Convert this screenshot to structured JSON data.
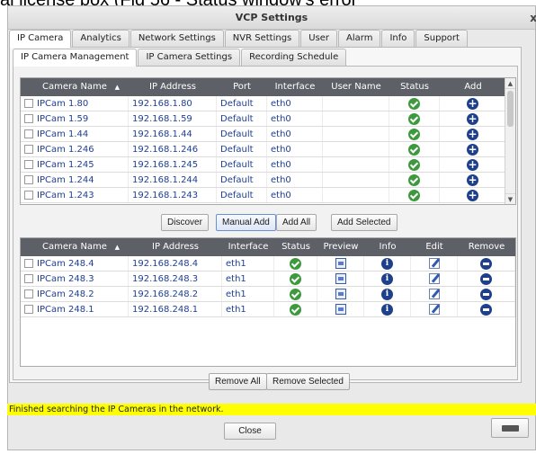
{
  "background_text": "al license box (Fig 56 - Status window's error",
  "window": {
    "title": "VCP Settings",
    "close": "x"
  },
  "main_tabs": [
    "IP Camera",
    "Analytics",
    "Network Settings",
    "NVR Settings",
    "User",
    "Alarm",
    "Info",
    "Support"
  ],
  "sub_tabs": [
    "IP Camera Management",
    "IP Camera Settings",
    "Recording Schedule"
  ],
  "discovered": {
    "headers": [
      "Camera Name",
      "IP Address",
      "Port",
      "Interface",
      "User Name",
      "Status",
      "Add"
    ],
    "sort_indicator": "▲",
    "rows": [
      {
        "name": "IPCam 1.80",
        "ip": "192.168.1.80",
        "port": "Default",
        "iface": "eth0",
        "user": "",
        "status": "ok-icon",
        "action": "add-icon"
      },
      {
        "name": "IPCam 1.59",
        "ip": "192.168.1.59",
        "port": "Default",
        "iface": "eth0",
        "user": "",
        "status": "ok-icon",
        "action": "add-icon"
      },
      {
        "name": "IPCam 1.44",
        "ip": "192.168.1.44",
        "port": "Default",
        "iface": "eth0",
        "user": "",
        "status": "ok-icon",
        "action": "add-icon"
      },
      {
        "name": "IPCam 1.246",
        "ip": "192.168.1.246",
        "port": "Default",
        "iface": "eth0",
        "user": "",
        "status": "ok-icon",
        "action": "add-icon"
      },
      {
        "name": "IPCam 1.245",
        "ip": "192.168.1.245",
        "port": "Default",
        "iface": "eth0",
        "user": "",
        "status": "ok-icon",
        "action": "add-icon"
      },
      {
        "name": "IPCam 1.244",
        "ip": "192.168.1.244",
        "port": "Default",
        "iface": "eth0",
        "user": "",
        "status": "ok-icon",
        "action": "add-icon"
      },
      {
        "name": "IPCam 1.243",
        "ip": "192.168.1.243",
        "port": "Default",
        "iface": "eth0",
        "user": "",
        "status": "ok-icon",
        "action": "add-icon"
      }
    ]
  },
  "buttons_top": [
    "Discover",
    "Manual Add",
    "Add All",
    "Add Selected"
  ],
  "added": {
    "headers": [
      "Camera Name",
      "IP Address",
      "Interface",
      "Status",
      "Preview",
      "Info",
      "Edit",
      "Remove"
    ],
    "sort_indicator": "▲",
    "rows": [
      {
        "name": "IPCam 248.4",
        "ip": "192.168.248.4",
        "iface": "eth1"
      },
      {
        "name": "IPCam 248.3",
        "ip": "192.168.248.3",
        "iface": "eth1"
      },
      {
        "name": "IPCam 248.2",
        "ip": "192.168.248.2",
        "iface": "eth1"
      },
      {
        "name": "IPCam 248.1",
        "ip": "192.168.248.1",
        "iface": "eth1"
      }
    ]
  },
  "buttons_bottom": [
    "Remove All",
    "Remove Selected"
  ],
  "status_message": "Finished searching the IP Cameras in the network.",
  "close_label": "Close",
  "icons": {
    "keyboard": "keyboard-icon",
    "status": "ok-icon",
    "add": "add-icon",
    "remove": "remove-icon",
    "info": "info-icon",
    "preview": "preview-icon",
    "edit": "edit-icon"
  },
  "colors": {
    "status_bar": "#ffff00",
    "header_bg": "#5d6066",
    "cell_text": "#1f3f94",
    "ok": "#3c9a3c",
    "action": "#1e3f8c"
  }
}
